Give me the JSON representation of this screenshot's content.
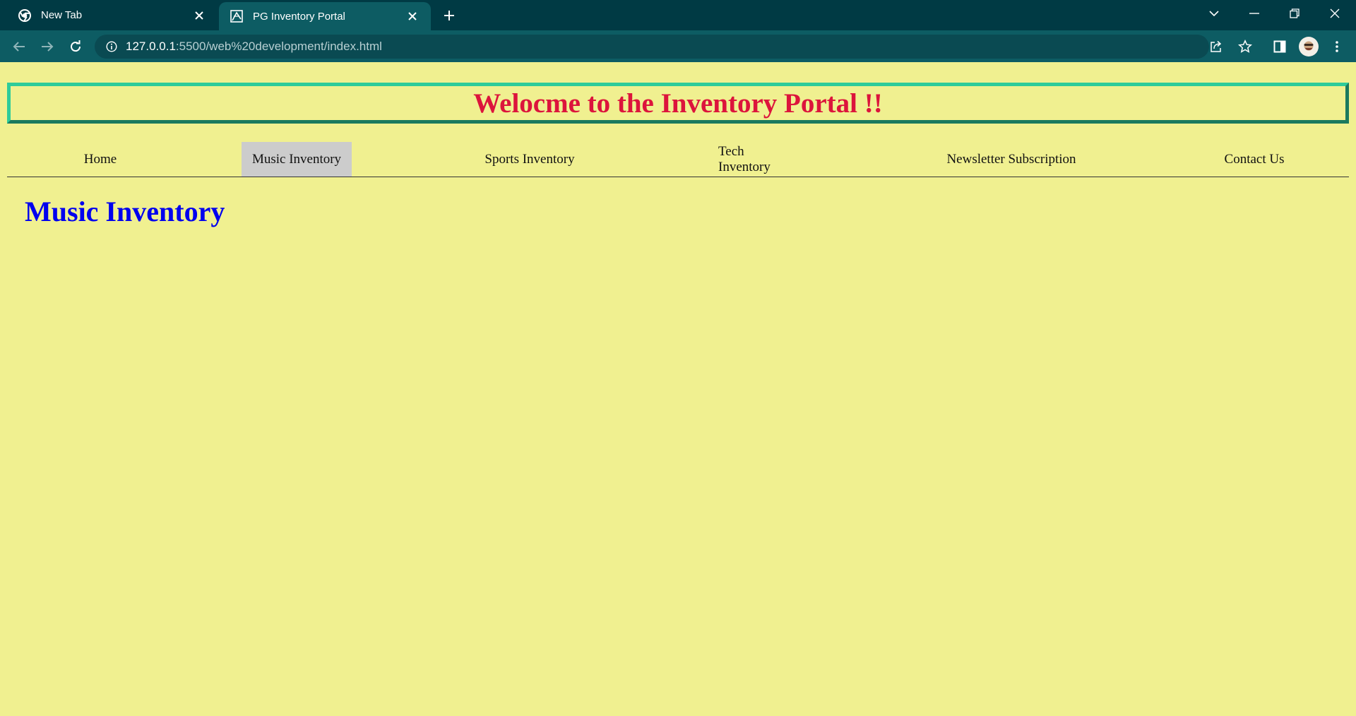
{
  "browser": {
    "tabs": [
      {
        "title": "New Tab",
        "icon": "chrome-icon",
        "active": false
      },
      {
        "title": "PG Inventory Portal",
        "icon": "page-favicon-icon",
        "active": true
      }
    ],
    "url_host": "127.0.0.1",
    "url_rest": ":5500/web%20development/index.html"
  },
  "page": {
    "banner_title": "Welocme to the Inventory Portal !!",
    "nav": [
      {
        "label": "Home"
      },
      {
        "label": "Music Inventory"
      },
      {
        "label": "Sports Inventory"
      },
      {
        "label": "Tech Inventory"
      },
      {
        "label": "Newsletter Subscription"
      },
      {
        "label": "Contact Us"
      }
    ],
    "active_nav": "Music Inventory",
    "section_title": "Music Inventory"
  },
  "colors": {
    "page_background": "#f0f090",
    "banner_text": "#dc143c",
    "banner_border": "#2ecc9a",
    "section_title": "#0000ee",
    "active_nav_background": "#cccccc",
    "chrome_frame": "#003a44",
    "chrome_toolbar": "#0d5c63"
  }
}
